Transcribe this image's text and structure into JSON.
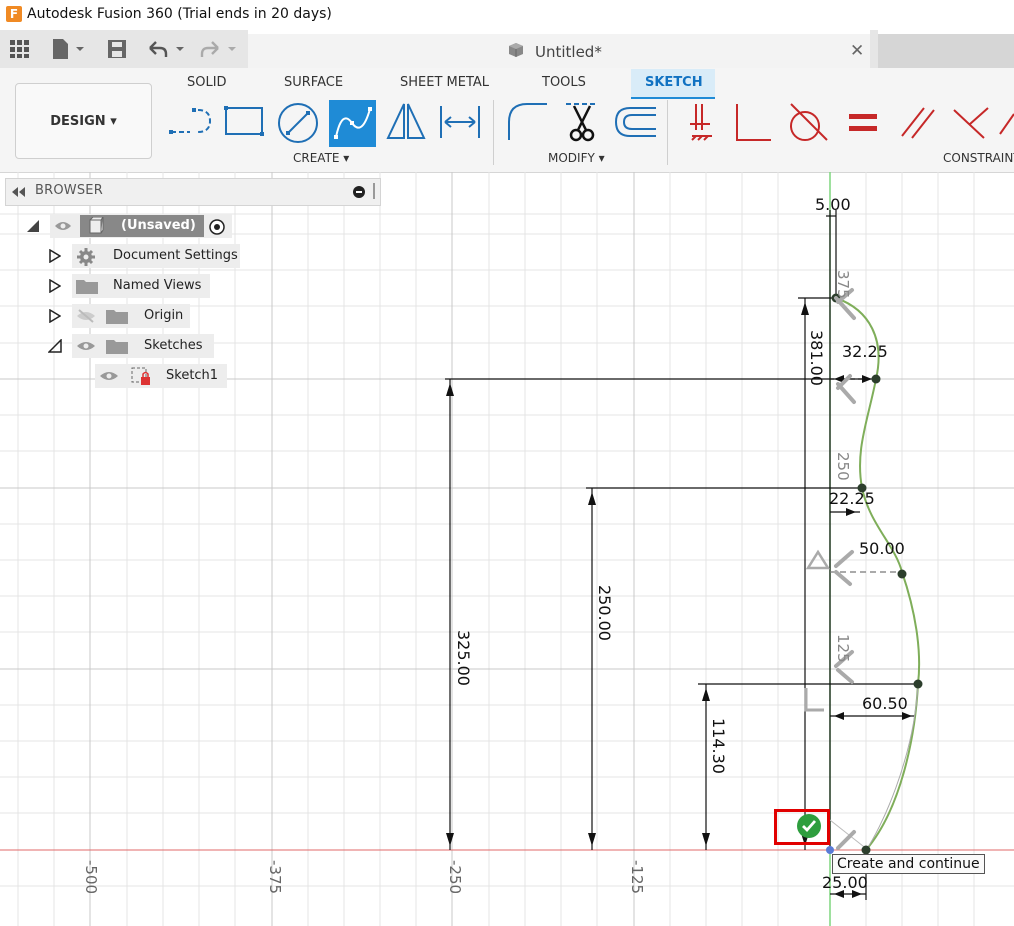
{
  "app": {
    "logo_letter": "F",
    "title": "Autodesk Fusion 360 (Trial ends in 20 days)"
  },
  "document": {
    "title": "Untitled*",
    "close_glyph": "✕"
  },
  "ribbon": {
    "tabs": [
      "SOLID",
      "SURFACE",
      "SHEET METAL",
      "TOOLS"
    ],
    "active_tab": "SKETCH",
    "workspace_button": "DESIGN ▾",
    "groups": {
      "create": "CREATE ▾",
      "modify": "MODIFY ▾",
      "constraints": "CONSTRAINTS"
    }
  },
  "browser": {
    "title": "BROWSER",
    "nodes": {
      "root": "(Unsaved)",
      "document_settings": "Document Settings",
      "named_views": "Named Views",
      "origin": "Origin",
      "sketches": "Sketches",
      "sketch1": "Sketch1"
    }
  },
  "canvas": {
    "dimensions": {
      "d5": "5.00",
      "d375": "375",
      "d381": "381.00",
      "d3225": "32.25",
      "d250small": "250",
      "d2225": "22.25",
      "d5000": "50.00",
      "d125small": "125",
      "d6050": "60.50",
      "d11430": "114.30",
      "d25000": "250.00",
      "d32500": "325.00",
      "d2500": "25.00"
    },
    "axis_labels": [
      "-500",
      "-375",
      "-250",
      "-125"
    ],
    "tooltip": "Create and continue"
  },
  "colors": {
    "accent": "#1f8bd6",
    "highlight": "#e10000",
    "spline": "#7fae5a",
    "axis_red": "#e06a6a",
    "axis_green": "#7fd67f"
  }
}
